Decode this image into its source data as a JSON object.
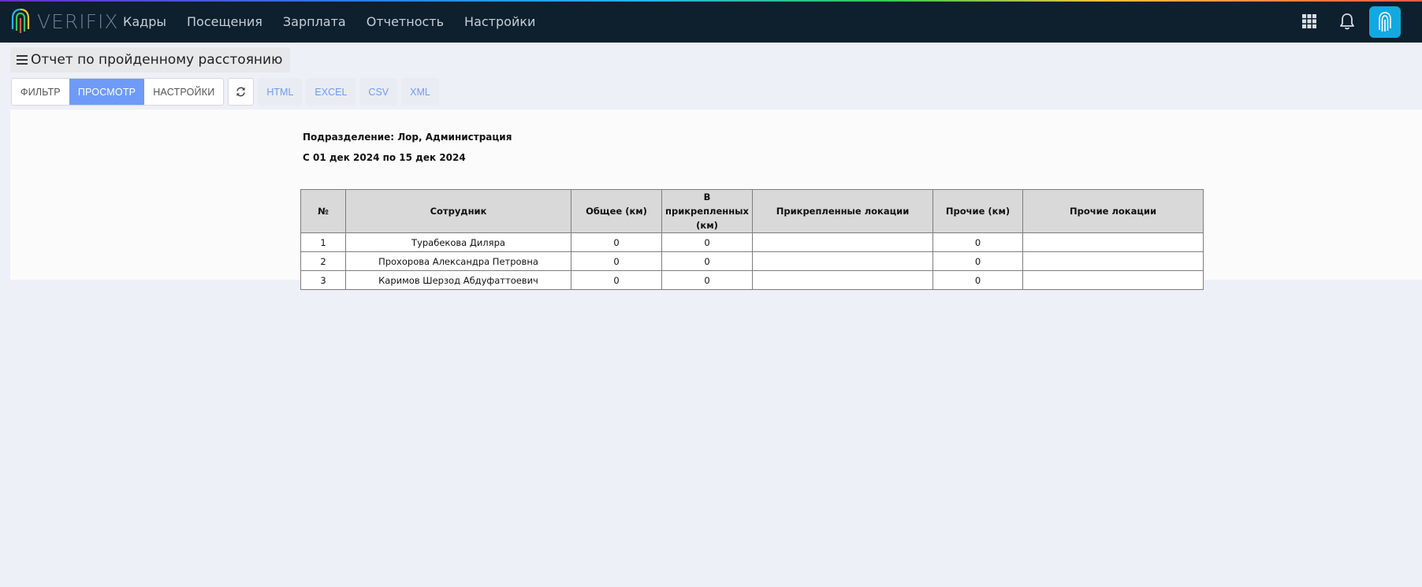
{
  "app": {
    "brand": "VERIFIX"
  },
  "nav": [
    "Кадры",
    "Посещения",
    "Зарплата",
    "Отчетность",
    "Настройки"
  ],
  "icons": {
    "apps": "apps-grid-icon",
    "notifications": "bell-icon",
    "avatar": "fingerprint-icon",
    "menu": "hamburger-icon",
    "refresh": "refresh-icon"
  },
  "colors": {
    "topbar": "#0e1f2d",
    "accent": "#6d9bf7",
    "avatar": "#12a9e0"
  },
  "page": {
    "title": "Отчет по пройденному расстоянию"
  },
  "toolbar": {
    "tabs": [
      "ФИЛЬТР",
      "ПРОСМОТР",
      "НАСТРОЙКИ"
    ],
    "active_tab": "ПРОСМОТР",
    "exports": [
      "HTML",
      "EXCEL",
      "CSV",
      "XML"
    ]
  },
  "report": {
    "division": "Подразделение: Лор, Администрация",
    "period": "С 01 дек 2024 по 15 дек 2024",
    "columns": [
      "№",
      "Сотрудник",
      "Общее (км)",
      "В прикрепленных (км)",
      "Прикрепленные локации",
      "Прочие (км)",
      "Прочие локации"
    ],
    "rows": [
      [
        "1",
        "Турабекова Диляра",
        "0",
        "0",
        "",
        "0",
        ""
      ],
      [
        "2",
        "Прохорова Александра Петровна",
        "0",
        "0",
        "",
        "0",
        ""
      ],
      [
        "3",
        "Каримов Шерзод Абдуфаттоевич",
        "0",
        "0",
        "",
        "0",
        ""
      ]
    ]
  }
}
